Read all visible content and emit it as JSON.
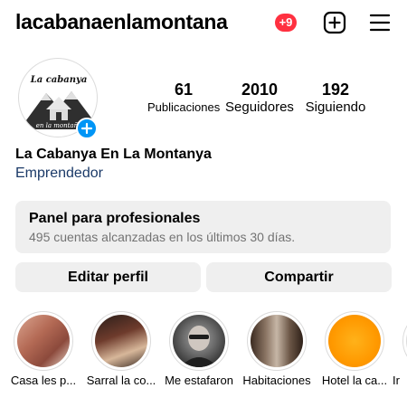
{
  "header": {
    "username": "lacabanaenlamontana",
    "notification_badge": "+9",
    "badge_color": "#ff3040",
    "new_post_icon": "plus-square-icon",
    "menu_icon": "hamburger-menu-icon"
  },
  "profile": {
    "avatar_text_top": "La cabanya",
    "avatar_text_bottom": "en la montaña",
    "add_story_icon": "plus-icon",
    "full_name": "La Cabanya En La Montanya",
    "category": "Emprendedor",
    "category_color": "#1b3a68"
  },
  "stats": [
    {
      "value": "61",
      "label": "Publicaciones"
    },
    {
      "value": "2010",
      "label": "Seguidores"
    },
    {
      "value": "192",
      "label": "Siguiendo"
    }
  ],
  "dashboard": {
    "title": "Panel para profesionales",
    "subtitle": "495 cuentas alcanzadas en los últimos 30 días."
  },
  "actions": {
    "edit": "Editar perfil",
    "share": "Compartir"
  },
  "highlights": [
    {
      "label": "Casa les p..."
    },
    {
      "label": "Sarral la co..."
    },
    {
      "label": "Me estafaron"
    },
    {
      "label": "Habitaciones"
    },
    {
      "label": "Hotel la ca..."
    },
    {
      "label": "Ir"
    }
  ],
  "accent_color": "#0095f6"
}
